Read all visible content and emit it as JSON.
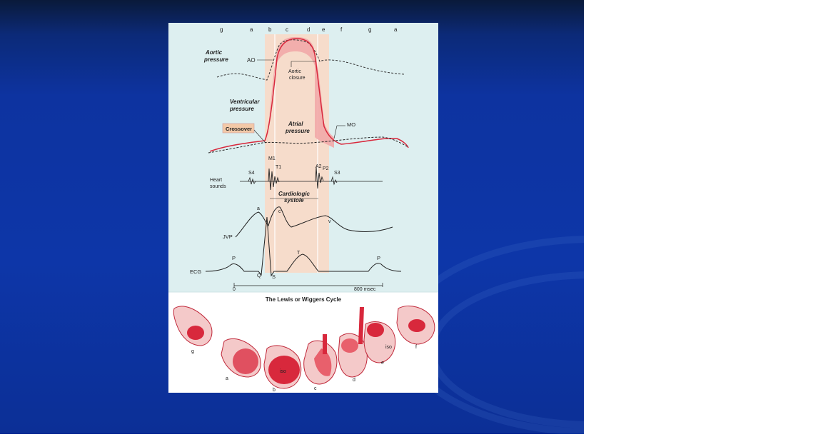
{
  "phase_labels": [
    "g",
    "a",
    "b",
    "c",
    "d",
    "e",
    "f",
    "g",
    "a"
  ],
  "labels": {
    "aortic_pressure": [
      "Aortic",
      "pressure"
    ],
    "ao": "AO",
    "aortic_closure": [
      "Aortic",
      "closure"
    ],
    "ventricular_pressure": [
      "Ventricular",
      "pressure"
    ],
    "atrial_pressure": [
      "Atrial",
      "pressure"
    ],
    "crossover": "Crossover",
    "mo": "MO",
    "heart_sounds": [
      "Heart",
      "sounds"
    ],
    "s4": "S4",
    "m1": "M1",
    "t1": "T1",
    "a2": "A2",
    "p2": "P2",
    "s3": "S3",
    "cardiologic_systole": [
      "Cardiologic",
      "systole"
    ],
    "jvp": "JVP",
    "jvp_a": "a",
    "jvp_c": "c",
    "jvp_v": "v",
    "ecg": "ECG",
    "ecg_p1": "P",
    "ecg_q": "Q",
    "ecg_s": "S",
    "ecg_t": "T",
    "ecg_p2": "P",
    "time_zero": "0",
    "time_end": "800 msec"
  },
  "caption": "The Lewis or Wiggers Cycle",
  "heart_stage_labels": [
    "g",
    "a",
    "b",
    "c",
    "d",
    "e",
    "f"
  ],
  "iso_label": "iso",
  "colors": {
    "panel_bg": "#ddeff0",
    "systole_band": "#f6dccb",
    "ventricle": "#d8283c",
    "crossover_box": "#f3c9a8"
  }
}
